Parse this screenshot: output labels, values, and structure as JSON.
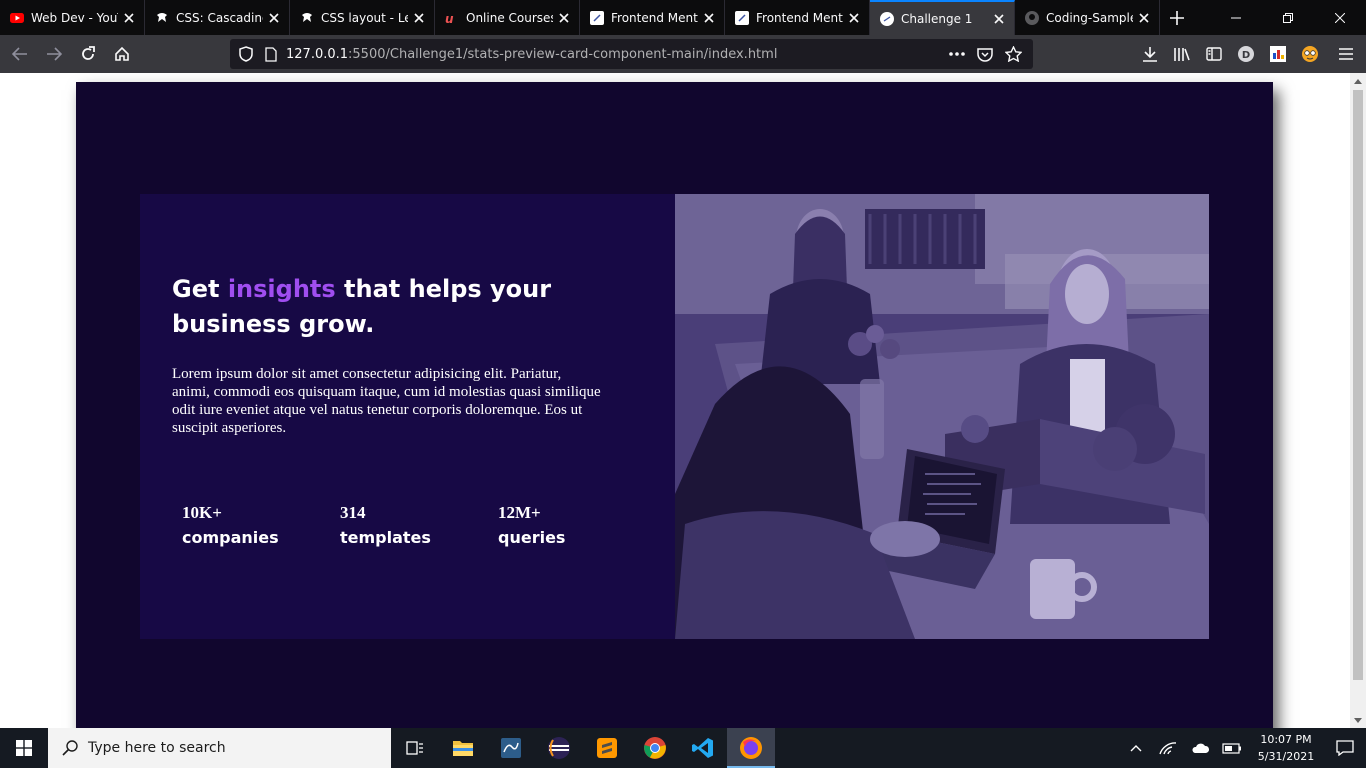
{
  "browser": {
    "tabs": [
      {
        "title": "Web Dev - YouT",
        "icon": "youtube-icon",
        "active": false
      },
      {
        "title": "CSS: Cascading",
        "icon": "mdn-icon",
        "active": false
      },
      {
        "title": "CSS layout - Lea",
        "icon": "mdn-icon",
        "active": false
      },
      {
        "title": "Online Courses",
        "icon": "udemy-icon",
        "active": false
      },
      {
        "title": "Frontend Mento",
        "icon": "frontend-mentor-icon",
        "active": false
      },
      {
        "title": "Frontend Mento",
        "icon": "frontend-mentor-icon",
        "active": false
      },
      {
        "title": "Challenge 1",
        "icon": "page-icon",
        "active": true
      },
      {
        "title": "Coding-Sample",
        "icon": "github-icon",
        "active": false
      }
    ],
    "url": {
      "host": "127.0.0.1",
      "rest": ":5500/Challenge1/stats-preview-card-component-main/index.html"
    },
    "profile_initial": "D",
    "accent_color": "#0a84ff"
  },
  "card": {
    "title_before": "Get ",
    "title_highlight": "insights",
    "title_after": " that helps your business grow.",
    "body": "Lorem ipsum dolor sit amet consectetur adipisicing elit. Pariatur, animi, commodi eos quisquam itaque, cum id molestias quasi similique odit iure eveniet atque vel natus tenetur corporis doloremque. Eos ut suscipit asperiores.",
    "stats": [
      {
        "value": "10K+",
        "label": "companies"
      },
      {
        "value": "314",
        "label": "templates"
      },
      {
        "value": "12M+",
        "label": "queries"
      }
    ],
    "colors": {
      "page_background": "#11062e",
      "card_background": "#170945",
      "accent": "#a04ef0",
      "image_overlay": "#463a73"
    }
  },
  "taskbar": {
    "search_placeholder": "Type here to search",
    "apps": [
      "task-view-icon",
      "file-explorer-icon",
      "mysql-workbench-icon",
      "eclipse-icon",
      "sublime-text-icon",
      "chrome-icon",
      "vscode-icon",
      "firefox-icon"
    ],
    "time": "10:07 PM",
    "date": "5/31/2021"
  }
}
